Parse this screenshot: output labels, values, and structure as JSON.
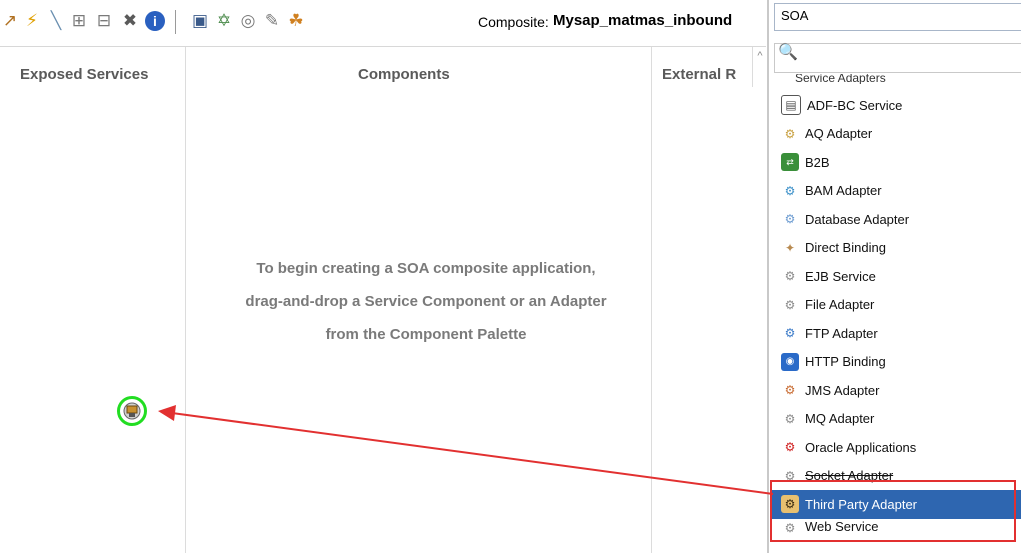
{
  "toolbar": {
    "composite_label": "Composite:",
    "composite_name": "Mysap_matmas_inbound",
    "icons": [
      "arrow-icon",
      "lightning-icon",
      "wire-icon",
      "add-icon",
      "remove-icon",
      "delete-icon",
      "info-icon",
      "layout-icon",
      "tree-icon",
      "refresh-icon",
      "edit-icon",
      "deploy-icon"
    ]
  },
  "canvas": {
    "columns": [
      "Exposed Services",
      "Components",
      "External R"
    ],
    "hint_lines": [
      "To begin creating a SOA composite application,",
      "drag-and-drop a Service Component or an Adapter",
      "from the Component Palette"
    ]
  },
  "palette": {
    "selected_category": "SOA",
    "section_label": "Service Adapters",
    "items": [
      {
        "label": "ADF-BC Service",
        "icon": "adfbc-icon",
        "color": "#6b6b6b"
      },
      {
        "label": "AQ Adapter",
        "icon": "aq-adapter-icon",
        "color": "#c8a040"
      },
      {
        "label": "B2B",
        "icon": "b2b-icon",
        "color": "#3a8f3a"
      },
      {
        "label": "BAM Adapter",
        "icon": "bam-adapter-icon",
        "color": "#3a8fc8"
      },
      {
        "label": "Database Adapter",
        "icon": "database-adapter-icon",
        "color": "#6a9ad0"
      },
      {
        "label": "Direct Binding",
        "icon": "direct-binding-icon",
        "color": "#b88a50"
      },
      {
        "label": "EJB Service",
        "icon": "ejb-service-icon",
        "color": "#8a8a8a"
      },
      {
        "label": "File Adapter",
        "icon": "file-adapter-icon",
        "color": "#8a8a8a"
      },
      {
        "label": "FTP Adapter",
        "icon": "ftp-adapter-icon",
        "color": "#3a7ac8"
      },
      {
        "label": "HTTP Binding",
        "icon": "http-binding-icon",
        "color": "#2a6ac8"
      },
      {
        "label": "JMS Adapter",
        "icon": "jms-adapter-icon",
        "color": "#c86a30"
      },
      {
        "label": "MQ Adapter",
        "icon": "mq-adapter-icon",
        "color": "#8a8a8a"
      },
      {
        "label": "Oracle Applications",
        "icon": "oracle-apps-icon",
        "color": "#d02020"
      },
      {
        "label": "Socket Adapter",
        "icon": "socket-adapter-icon",
        "color": "#8a8a8a"
      },
      {
        "label": "Third Party Adapter",
        "icon": "third-party-adapter-icon",
        "color": "#c89030"
      },
      {
        "label": "Web Service",
        "icon": "web-service-icon",
        "color": "#8a8a8a"
      }
    ]
  },
  "colors": {
    "selection": "#2e66b0",
    "annotation": "#e23030",
    "drop_ring": "#22dd22"
  }
}
